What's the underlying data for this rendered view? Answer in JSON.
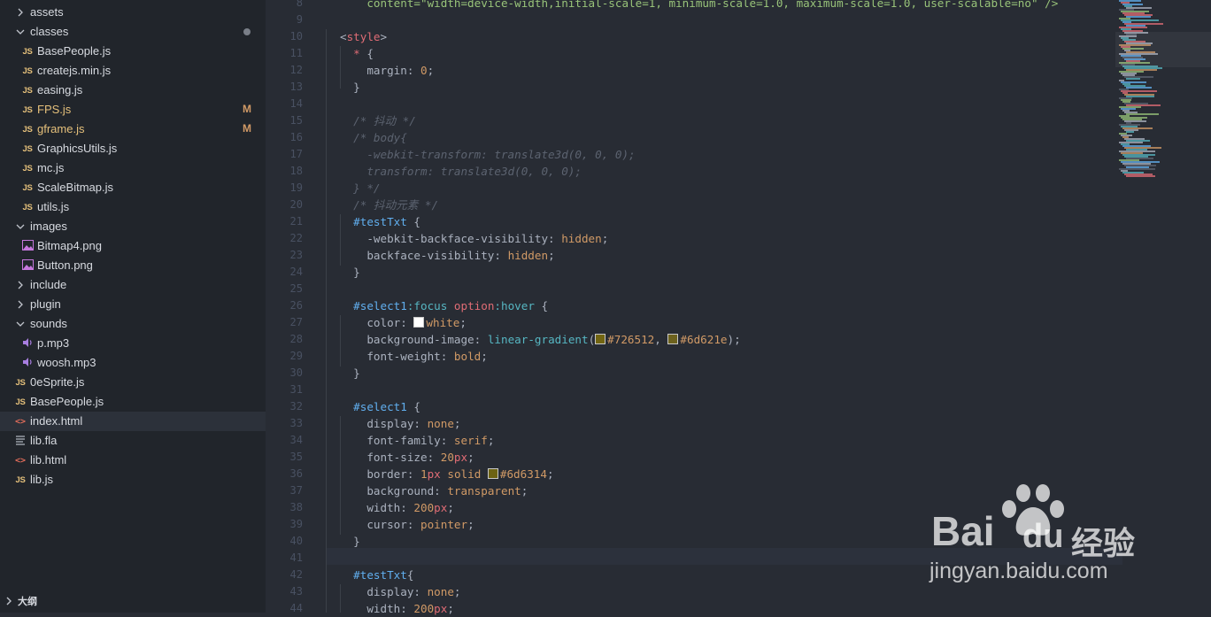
{
  "explorer": {
    "items": [
      {
        "kind": "folder",
        "label": "assets",
        "state": "collapsed",
        "depth": 0
      },
      {
        "kind": "folder",
        "label": "classes",
        "state": "expanded",
        "depth": 0,
        "modified_dot": true
      },
      {
        "kind": "js",
        "label": "BasePeople.js",
        "depth": 1
      },
      {
        "kind": "js",
        "label": "createjs.min.js",
        "depth": 1
      },
      {
        "kind": "js",
        "label": "easing.js",
        "depth": 1
      },
      {
        "kind": "js",
        "label": "FPS.js",
        "depth": 1,
        "badge": "M"
      },
      {
        "kind": "js",
        "label": "gframe.js",
        "depth": 1,
        "badge": "M"
      },
      {
        "kind": "js",
        "label": "GraphicsUtils.js",
        "depth": 1
      },
      {
        "kind": "js",
        "label": "mc.js",
        "depth": 1
      },
      {
        "kind": "js",
        "label": "ScaleBitmap.js",
        "depth": 1
      },
      {
        "kind": "js",
        "label": "utils.js",
        "depth": 1
      },
      {
        "kind": "folder",
        "label": "images",
        "state": "expanded",
        "depth": 0
      },
      {
        "kind": "image",
        "label": "Bitmap4.png",
        "depth": 1
      },
      {
        "kind": "image",
        "label": "Button.png",
        "depth": 1
      },
      {
        "kind": "folder",
        "label": "include",
        "state": "collapsed",
        "depth": 0
      },
      {
        "kind": "folder",
        "label": "plugin",
        "state": "collapsed",
        "depth": 0
      },
      {
        "kind": "folder",
        "label": "sounds",
        "state": "expanded",
        "depth": 0
      },
      {
        "kind": "audio",
        "label": "p.mp3",
        "depth": 1
      },
      {
        "kind": "audio",
        "label": "woosh.mp3",
        "depth": 1
      },
      {
        "kind": "js",
        "label": "0eSprite.js",
        "depth": 0
      },
      {
        "kind": "js",
        "label": "BasePeople.js",
        "depth": 0
      },
      {
        "kind": "html",
        "label": "index.html",
        "depth": 0,
        "selected": true
      },
      {
        "kind": "file",
        "label": "lib.fla",
        "depth": 0
      },
      {
        "kind": "html",
        "label": "lib.html",
        "depth": 0
      },
      {
        "kind": "js",
        "label": "lib.js",
        "depth": 0
      }
    ],
    "js_icon_text": "JS",
    "html_icon_text": "<>"
  },
  "outline": {
    "label": "大纲"
  },
  "editor": {
    "current_line": 41,
    "lines": [
      {
        "n": "8",
        "tokens": [
          [
            "t-str",
            "    content=\"width=device-width,initial-scale=1, minimum-scale=1.0, maximum-scale=1.0, user-scalable=no\" />"
          ]
        ]
      },
      {
        "n": "9",
        "tokens": []
      },
      {
        "n": "10",
        "tokens": [
          [
            "t-punc",
            "<"
          ],
          [
            "t-tag",
            "style"
          ],
          [
            "t-punc",
            ">"
          ]
        ]
      },
      {
        "n": "11",
        "tokens": [
          [
            "t-sel",
            "  * "
          ],
          [
            "t-punc",
            "{"
          ]
        ]
      },
      {
        "n": "12",
        "tokens": [
          [
            "t-prop",
            "    margin"
          ],
          [
            "t-punc",
            ": "
          ],
          [
            "t-num",
            "0"
          ],
          [
            "t-punc",
            ";"
          ]
        ]
      },
      {
        "n": "13",
        "tokens": [
          [
            "t-punc",
            "  }"
          ]
        ]
      },
      {
        "n": "14",
        "tokens": []
      },
      {
        "n": "15",
        "tokens": [
          [
            "t-com",
            "  /* 抖动 */"
          ]
        ]
      },
      {
        "n": "16",
        "tokens": [
          [
            "t-com",
            "  /* body{"
          ]
        ]
      },
      {
        "n": "17",
        "tokens": [
          [
            "t-com",
            "    -webkit-transform: translate3d(0, 0, 0);"
          ]
        ]
      },
      {
        "n": "18",
        "tokens": [
          [
            "t-com",
            "    transform: translate3d(0, 0, 0);"
          ]
        ]
      },
      {
        "n": "19",
        "tokens": [
          [
            "t-com",
            "  } */"
          ]
        ]
      },
      {
        "n": "20",
        "tokens": [
          [
            "t-com",
            "  /* 抖动元素 */"
          ]
        ]
      },
      {
        "n": "21",
        "tokens": [
          [
            "t-id",
            "  #testTxt"
          ],
          [
            "t-punc",
            " {"
          ]
        ]
      },
      {
        "n": "22",
        "tokens": [
          [
            "t-prop",
            "    -webkit-backface-visibility"
          ],
          [
            "t-punc",
            ": "
          ],
          [
            "t-kw",
            "hidden"
          ],
          [
            "t-punc",
            ";"
          ]
        ]
      },
      {
        "n": "23",
        "tokens": [
          [
            "t-prop",
            "    backface-visibility"
          ],
          [
            "t-punc",
            ": "
          ],
          [
            "t-kw",
            "hidden"
          ],
          [
            "t-punc",
            ";"
          ]
        ]
      },
      {
        "n": "24",
        "tokens": [
          [
            "t-punc",
            "  }"
          ]
        ]
      },
      {
        "n": "25",
        "tokens": []
      },
      {
        "n": "26",
        "tokens": [
          [
            "t-id",
            "  #select1"
          ],
          [
            "t-pseudo",
            ":focus"
          ],
          [
            "t-punc",
            " "
          ],
          [
            "t-sel",
            "option"
          ],
          [
            "t-pseudo",
            ":hover"
          ],
          [
            "t-punc",
            " {"
          ]
        ]
      },
      {
        "n": "27",
        "tokens": [
          [
            "t-prop",
            "    color"
          ],
          [
            "t-punc",
            ": "
          ],
          [
            "swatch",
            "#ffffff"
          ],
          [
            "t-kw",
            "white"
          ],
          [
            "t-punc",
            ";"
          ]
        ]
      },
      {
        "n": "28",
        "tokens": [
          [
            "t-prop",
            "    background-image"
          ],
          [
            "t-punc",
            ": "
          ],
          [
            "t-fn",
            "linear-gradient"
          ],
          [
            "t-punc",
            "("
          ],
          [
            "swatch",
            "#726512"
          ],
          [
            "t-hex",
            "#726512"
          ],
          [
            "t-punc",
            ", "
          ],
          [
            "swatch",
            "#6d621e"
          ],
          [
            "t-hex",
            "#6d621e"
          ],
          [
            "t-punc",
            ");"
          ]
        ]
      },
      {
        "n": "29",
        "tokens": [
          [
            "t-prop",
            "    font-weight"
          ],
          [
            "t-punc",
            ": "
          ],
          [
            "t-kw",
            "bold"
          ],
          [
            "t-punc",
            ";"
          ]
        ]
      },
      {
        "n": "30",
        "tokens": [
          [
            "t-punc",
            "  }"
          ]
        ]
      },
      {
        "n": "31",
        "tokens": []
      },
      {
        "n": "32",
        "tokens": [
          [
            "t-id",
            "  #select1"
          ],
          [
            "t-punc",
            " {"
          ]
        ]
      },
      {
        "n": "33",
        "tokens": [
          [
            "t-prop",
            "    display"
          ],
          [
            "t-punc",
            ": "
          ],
          [
            "t-kw",
            "none"
          ],
          [
            "t-punc",
            ";"
          ]
        ]
      },
      {
        "n": "34",
        "tokens": [
          [
            "t-prop",
            "    font-family"
          ],
          [
            "t-punc",
            ": "
          ],
          [
            "t-kw",
            "serif"
          ],
          [
            "t-punc",
            ";"
          ]
        ]
      },
      {
        "n": "35",
        "tokens": [
          [
            "t-prop",
            "    font-size"
          ],
          [
            "t-punc",
            ": "
          ],
          [
            "t-num",
            "20"
          ],
          [
            "t-unit",
            "px"
          ],
          [
            "t-punc",
            ";"
          ]
        ]
      },
      {
        "n": "36",
        "tokens": [
          [
            "t-prop",
            "    border"
          ],
          [
            "t-punc",
            ": "
          ],
          [
            "t-num",
            "1"
          ],
          [
            "t-unit",
            "px"
          ],
          [
            "t-punc",
            " "
          ],
          [
            "t-kw",
            "solid"
          ],
          [
            "t-punc",
            " "
          ],
          [
            "swatch",
            "#6d6314"
          ],
          [
            "t-hex",
            "#6d6314"
          ],
          [
            "t-punc",
            ";"
          ]
        ]
      },
      {
        "n": "37",
        "tokens": [
          [
            "t-prop",
            "    background"
          ],
          [
            "t-punc",
            ": "
          ],
          [
            "t-kw",
            "transparent"
          ],
          [
            "t-punc",
            ";"
          ]
        ]
      },
      {
        "n": "38",
        "tokens": [
          [
            "t-prop",
            "    width"
          ],
          [
            "t-punc",
            ": "
          ],
          [
            "t-num",
            "200"
          ],
          [
            "t-unit",
            "px"
          ],
          [
            "t-punc",
            ";"
          ]
        ]
      },
      {
        "n": "39",
        "tokens": [
          [
            "t-prop",
            "    cursor"
          ],
          [
            "t-punc",
            ": "
          ],
          [
            "t-kw",
            "pointer"
          ],
          [
            "t-punc",
            ";"
          ]
        ]
      },
      {
        "n": "40",
        "tokens": [
          [
            "t-punc",
            "  }"
          ]
        ]
      },
      {
        "n": "41",
        "tokens": []
      },
      {
        "n": "42",
        "tokens": [
          [
            "t-id",
            "  #testTxt"
          ],
          [
            "t-punc",
            "{"
          ]
        ]
      },
      {
        "n": "43",
        "tokens": [
          [
            "t-prop",
            "    display"
          ],
          [
            "t-punc",
            ": "
          ],
          [
            "t-kw",
            "none"
          ],
          [
            "t-punc",
            ";"
          ]
        ]
      },
      {
        "n": "44",
        "tokens": [
          [
            "t-prop",
            "    width"
          ],
          [
            "t-punc",
            ": "
          ],
          [
            "t-num",
            "200"
          ],
          [
            "t-unit",
            "px"
          ],
          [
            "t-punc",
            ";"
          ]
        ]
      }
    ]
  },
  "watermark": {
    "brand_left": "Bai",
    "brand_right": "du",
    "chinese": "经验",
    "url": "jingyan.baidu.com"
  },
  "colors": {
    "sidebar_bg": "#21252b",
    "editor_bg": "#282c34",
    "modified_badge": "#d19a66",
    "js_icon": "#e5c07b",
    "html_icon": "#e06c5a",
    "image_icon": "#c678dd",
    "audio_icon": "#a87ee0"
  }
}
